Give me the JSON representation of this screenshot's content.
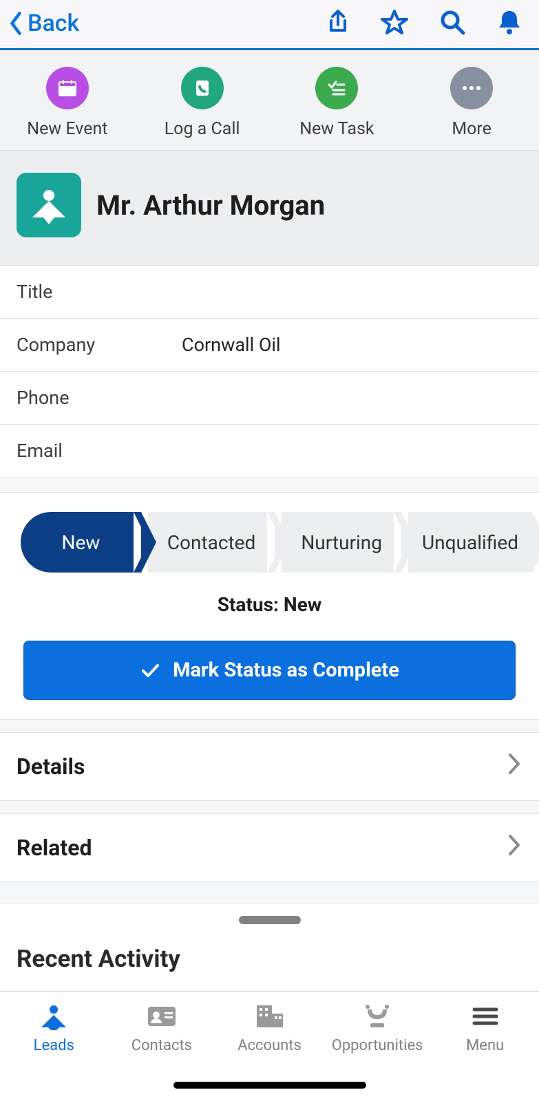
{
  "header": {
    "back_label": "Back"
  },
  "quick_actions": {
    "new_event": "New Event",
    "log_call": "Log a Call",
    "new_task": "New Task",
    "more": "More"
  },
  "lead": {
    "name": "Mr. Arthur Morgan",
    "fields": {
      "title_label": "Title",
      "title_value": "",
      "company_label": "Company",
      "company_value": "Cornwall Oil",
      "phone_label": "Phone",
      "phone_value": "",
      "email_label": "Email",
      "email_value": ""
    }
  },
  "path": {
    "stages": [
      "New",
      "Contacted",
      "Nurturing",
      "Unqualified"
    ],
    "status_prefix": "Status: ",
    "status_value": "New",
    "mark_complete": "Mark Status as Complete"
  },
  "sections": {
    "details": "Details",
    "related": "Related",
    "recent_activity": "Recent Activity"
  },
  "tabs": {
    "leads": "Leads",
    "contacts": "Contacts",
    "accounts": "Accounts",
    "opportunities": "Opportunities",
    "menu": "Menu"
  }
}
